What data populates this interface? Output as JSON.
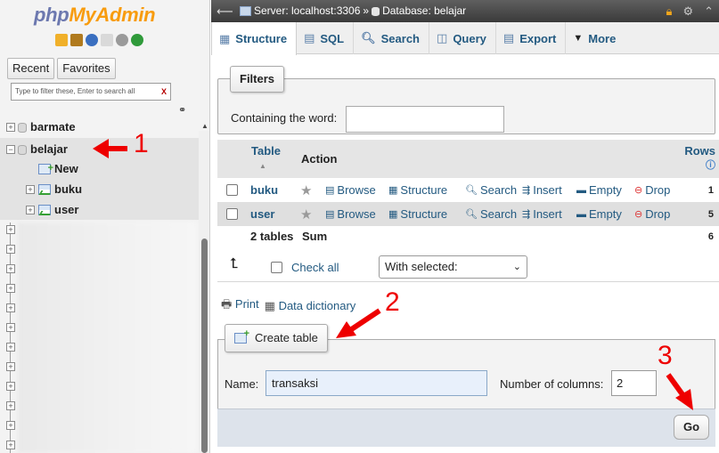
{
  "nav": {
    "logo_php": "php",
    "logo_myadmin": "MyAdmin",
    "tabs": [
      "Recent",
      "Favorites"
    ],
    "filter_placeholder": "Type to filter these, Enter to search all",
    "filter_clear": "X",
    "databases": [
      {
        "name": "barmate",
        "expanded": false
      },
      {
        "name": "belajar",
        "expanded": true,
        "children": [
          "New",
          "buku",
          "user"
        ]
      }
    ]
  },
  "serverbar": {
    "server": "Server: localhost:3306",
    "separator": "»",
    "database": "Database: belajar"
  },
  "tabs": [
    {
      "label": "Structure",
      "icon": "structure-icon",
      "active": true
    },
    {
      "label": "SQL",
      "icon": "sql-icon"
    },
    {
      "label": "Search",
      "icon": "search-icon"
    },
    {
      "label": "Query",
      "icon": "query-icon"
    },
    {
      "label": "Export",
      "icon": "export-icon"
    },
    {
      "label": "More",
      "icon": "chevron-down-icon"
    }
  ],
  "filters": {
    "legend": "Filters",
    "label": "Containing the word:",
    "value": ""
  },
  "table": {
    "headers": {
      "table": "Table",
      "action": "Action",
      "rows": "Rows"
    },
    "rows": [
      {
        "name": "buku",
        "rows": "1"
      },
      {
        "name": "user",
        "rows": "5"
      }
    ],
    "actions": [
      "Browse",
      "Structure",
      "Search",
      "Insert",
      "Empty",
      "Drop"
    ],
    "summary": {
      "count": "2 tables",
      "label": "Sum",
      "rows": "6"
    }
  },
  "bulk": {
    "check_all": "Check all",
    "with_selected": "With selected:"
  },
  "links": {
    "print": "Print",
    "data_dictionary": "Data dictionary"
  },
  "create": {
    "legend": "Create table",
    "name_label": "Name:",
    "name_value": "transaksi",
    "columns_label": "Number of columns:",
    "columns_value": "2",
    "go": "Go"
  },
  "annotations": [
    "1",
    "2",
    "3"
  ],
  "colors": {
    "accent_link": "#235a81",
    "annotation": "#ee0000",
    "logo_php": "#6c78af",
    "logo_myadmin": "#f89c0e"
  }
}
